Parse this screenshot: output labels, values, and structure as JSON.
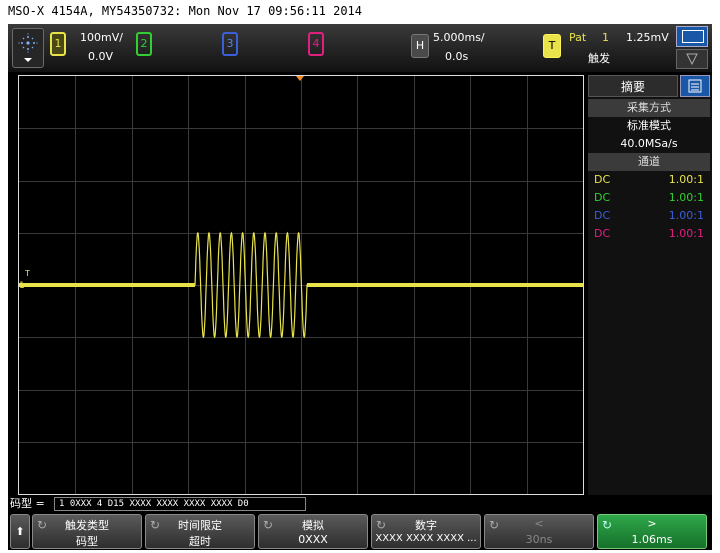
{
  "window_title": "MSO-X 4154A, MY54350732: Mon Nov 17 09:56:11 2014",
  "channels": {
    "ch1": {
      "label": "1",
      "scale": "100mV/",
      "offset": "0.0V",
      "color": "#e8e34a"
    },
    "ch2": {
      "label": "2",
      "color": "#30d030"
    },
    "ch3": {
      "label": "3",
      "color": "#3a5fd8"
    },
    "ch4": {
      "label": "4",
      "color": "#e02080"
    }
  },
  "horizontal": {
    "label": "H",
    "scale": "5.000ms/",
    "delay": "0.0s"
  },
  "trigger": {
    "label": "T",
    "type": "Pat",
    "channel": "1",
    "level": "1.25mV",
    "mode": "触发"
  },
  "sidebar": {
    "tab": "摘要",
    "acq_header": "采集方式",
    "acq_mode": "标准模式",
    "sample_rate": "40.0MSa/s",
    "channel_header": "通道",
    "channels": [
      {
        "coupling": "DC",
        "ratio": "1.00:1",
        "color": "#e8e34a"
      },
      {
        "coupling": "DC",
        "ratio": "1.00:1",
        "color": "#30d030"
      },
      {
        "coupling": "DC",
        "ratio": "1.00:1",
        "color": "#3a5fd8"
      },
      {
        "coupling": "DC",
        "ratio": "1.00:1",
        "color": "#e02080"
      }
    ]
  },
  "trigger_pattern": {
    "label": "码型 =",
    "value": "1 0XXX 4 D15 XXXX XXXX XXXX XXXX D0"
  },
  "softkeys": {
    "back": "⬆",
    "trigger_type": {
      "title": "触发类型",
      "value": "码型"
    },
    "time_qualifier": {
      "title": "时间限定",
      "value": "超时"
    },
    "analog": {
      "title": "模拟",
      "value": "0XXX"
    },
    "digital": {
      "title": "数字",
      "value": "XXXX XXXX XXXX ..."
    },
    "less": {
      "title": "<",
      "value": "30ns"
    },
    "greater": {
      "title": ">",
      "value": "1.06ms"
    }
  },
  "markers": {
    "ground_label": "1",
    "trigger_label": "T"
  },
  "signal": {
    "color": "#e8e34a",
    "burst_cycles": 10
  }
}
